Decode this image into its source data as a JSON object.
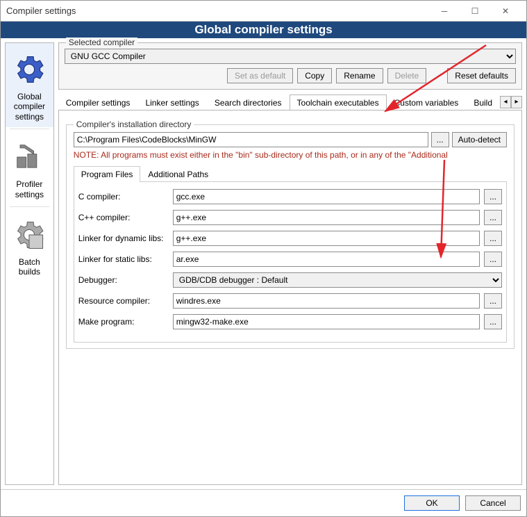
{
  "window": {
    "title": "Compiler settings"
  },
  "banner": "Global compiler settings",
  "sidebar": {
    "items": [
      {
        "label": "Global compiler settings",
        "selected": true
      },
      {
        "label": "Profiler settings",
        "selected": false
      },
      {
        "label": "Batch builds",
        "selected": false
      }
    ]
  },
  "selected_compiler": {
    "label": "Selected compiler",
    "value": "GNU GCC Compiler",
    "buttons": {
      "set_default": "Set as default",
      "copy": "Copy",
      "rename": "Rename",
      "delete": "Delete",
      "reset": "Reset defaults"
    }
  },
  "tabs": [
    "Compiler settings",
    "Linker settings",
    "Search directories",
    "Toolchain executables",
    "Custom variables",
    "Build"
  ],
  "selected_tab": "Toolchain executables",
  "install": {
    "label": "Compiler's installation directory",
    "path": "C:\\Program Files\\CodeBlocks\\MinGW",
    "auto_label": "Auto-detect",
    "note": "NOTE: All programs must exist either in the \"bin\" sub-directory of this path, or in any of the \"Additional"
  },
  "subtabs": [
    "Program Files",
    "Additional Paths"
  ],
  "selected_subtab": "Program Files",
  "programs": {
    "c_compiler": {
      "label": "C compiler:",
      "value": "gcc.exe"
    },
    "cxx_compiler": {
      "label": "C++ compiler:",
      "value": "g++.exe"
    },
    "linker_dyn": {
      "label": "Linker for dynamic libs:",
      "value": "g++.exe"
    },
    "linker_static": {
      "label": "Linker for static libs:",
      "value": "ar.exe"
    },
    "debugger": {
      "label": "Debugger:",
      "value": "GDB/CDB debugger : Default"
    },
    "resource": {
      "label": "Resource compiler:",
      "value": "windres.exe"
    },
    "make": {
      "label": "Make program:",
      "value": "mingw32-make.exe"
    }
  },
  "footer": {
    "ok": "OK",
    "cancel": "Cancel"
  }
}
